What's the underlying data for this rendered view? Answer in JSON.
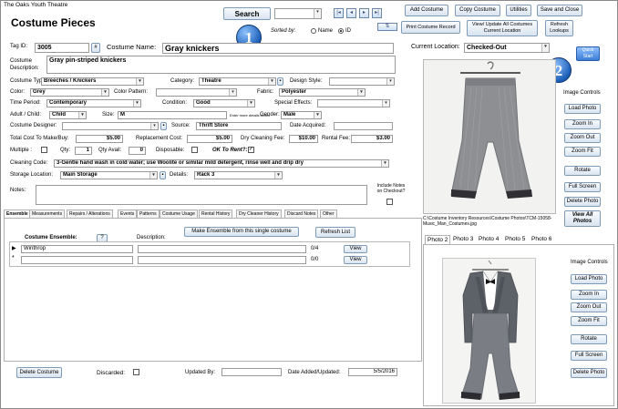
{
  "window": {
    "title": "The Oaks Youth Theatre"
  },
  "header": {
    "form_title": "Costume Pieces",
    "search_label": "Search",
    "sorted_by_label": "Sorted by:",
    "sort_options": [
      "Name",
      "ID"
    ],
    "sort_selected": "ID",
    "nav": [
      "first-record",
      "previous-record",
      "next-record",
      "last-record"
    ],
    "buttons": {
      "add_costume": "Add Costume",
      "copy_costume": "Copy Costume",
      "utilities": "Utilities",
      "save_close": "Save and Close",
      "print_record": "Print Costume Record",
      "view_update": "View/ Update All Costumes Current Location",
      "refresh_lookups": "Refresh Lookups"
    }
  },
  "badges": {
    "one": "1",
    "two": "2"
  },
  "quick_start": "Quick Start",
  "form": {
    "tag_id_label": "Tag ID:",
    "tag_id": "3005",
    "hash_button": "#",
    "costume_name_label": "Costume Name:",
    "costume_name": "Gray knickers",
    "current_location_label": "Current Location:",
    "current_location": "Checked-Out",
    "description_label": "Costume Description:",
    "description": "Gray pin-striped knickers",
    "costume_type_label": "Costume Type:",
    "costume_type": "Breeches / Knickers",
    "category_label": "Category:",
    "category": "Theatre",
    "design_style_label": "Design Style:",
    "design_style": "",
    "color_label": "Color:",
    "color": "Grey",
    "color_pattern_label": "Color Pattern:",
    "color_pattern": "",
    "fabric_label": "Fabric:",
    "fabric": "Polyester",
    "time_period_label": "Time Period:",
    "time_period": "Contemporary",
    "condition_label": "Condition:",
    "condition": "Good",
    "special_effects_label": "Special Effects:",
    "special_effects": "",
    "adult_child_label": "Adult / Child:",
    "adult_child": "Child",
    "size_label": "Size:",
    "size": "M",
    "size_hint": "Enter more details below",
    "gender_label": "Gender:",
    "gender": "Male",
    "designer_label": "Costume Designer:",
    "designer": "",
    "source_label": "Source:",
    "source": "Thrift Store",
    "date_acquired_label": "Date Acquired:",
    "date_acquired": "",
    "total_cost_label": "Total Cost To Make/Buy:",
    "total_cost": "$5.00",
    "replacement_cost_label": "Replacement Cost:",
    "replacement_cost": "$5.00",
    "dry_cleaning_fee_label": "Dry Cleaning Fee:",
    "dry_cleaning_fee": "$10.00",
    "rental_fee_label": "Rental Fee:",
    "rental_fee": "$3.00",
    "multiple_label": "Multiple :",
    "qty_label": "Qty:",
    "qty": "1",
    "qty_avail_label": "Qty Avail:",
    "qty_avail": "0",
    "disposable_label": "Disposable:",
    "ok_to_rent_label": "OK To Rent?:",
    "cleaning_code_label": "Cleaning Code:",
    "cleaning_code": "3-Gentle hand wash in cold water; use Woolite or similar mild detergent, rinse well and drip dry",
    "storage_location_label": "Storage Location:",
    "storage_location": "Main Storage",
    "details_label": "Details:",
    "details": "Rack 3",
    "notes_label": "Notes:",
    "include_notes_label": "Include Notes on Checkout?"
  },
  "tabs": [
    "Ensemble",
    "Measurements",
    "Repairs / Alterations",
    "Events",
    "Patterns",
    "Costume Usage",
    "Rental History",
    "Dry Cleaner History",
    "Discard Notes",
    "Other"
  ],
  "ensemble": {
    "costume_ensemble_label": "Costume Ensemble:",
    "help_button": "?",
    "description_label": "Description:",
    "make_button": "Make Ensemble from this single costume",
    "refresh_button": "Refresh List",
    "rows": [
      {
        "name": "Winthrop",
        "description": "",
        "count": "0/4",
        "view": "View"
      },
      {
        "name": "",
        "description": "",
        "count": "0/0",
        "view": "View"
      }
    ]
  },
  "footer": {
    "delete_button": "Delete Costume",
    "discarded_label": "Discarded:",
    "updated_by_label": "Updated By:",
    "updated_by": "",
    "date_label": "Date Added/Updated:",
    "date": "5/5/2016"
  },
  "photo1": {
    "path": "C:\\Costume Inventory Resources\\Costume Photos\\TCM-15058-Music_Man_Costumes.jpg",
    "controls_label": "Image Controls",
    "buttons": [
      "Load Photo",
      "Zoom In",
      "Zoom Out",
      "Zoom Fit",
      "Rotate",
      "Full Screen",
      "Delete Photo",
      "View All Photos"
    ]
  },
  "photo_tabs": [
    "Photo 2",
    "Photo 3",
    "Photo 4",
    "Photo 5",
    "Photo 6"
  ],
  "photo2": {
    "controls_label": "Image Controls",
    "buttons": [
      "Load Photo",
      "Zoom In",
      "Zoom Out",
      "Zoom Fit",
      "Rotate",
      "Full Screen",
      "Delete Photo"
    ]
  }
}
